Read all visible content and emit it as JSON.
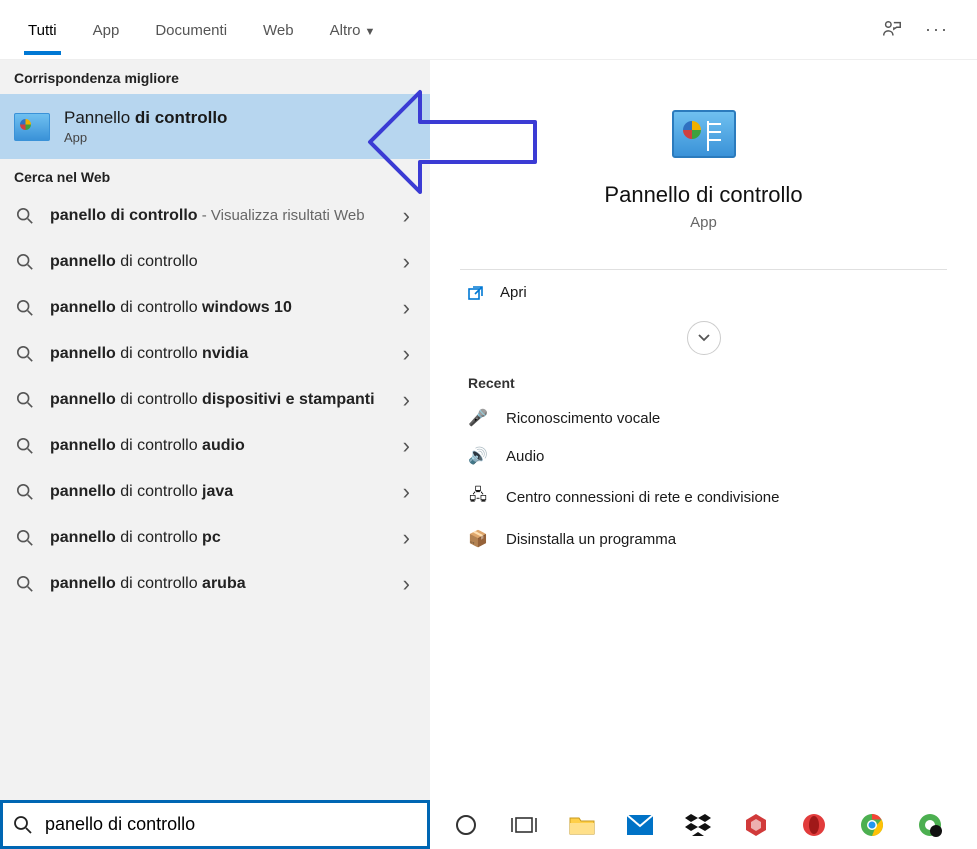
{
  "tabs": {
    "all": "Tutti",
    "apps": "App",
    "documents": "Documenti",
    "web": "Web",
    "more": "Altro"
  },
  "sections": {
    "best_match": "Corrispondenza migliore",
    "web_search": "Cerca nel Web",
    "recent": "Recent"
  },
  "best_match": {
    "title_prefix": "Pannello ",
    "title_bold": "di controllo",
    "subtitle": "App"
  },
  "web_results": [
    {
      "bold": "panello di controllo",
      "rest": "",
      "hint": " - Visualizza risultati Web"
    },
    {
      "bold": "pannello",
      "rest": " di controllo",
      "hint": ""
    },
    {
      "bold": "pannello",
      "rest": " di controllo ",
      "bold2": "windows 10"
    },
    {
      "bold": "pannello",
      "rest": " di controllo ",
      "bold2": "nvidia"
    },
    {
      "bold": "pannello",
      "rest": " di controllo ",
      "bold2": "dispositivi e stampanti"
    },
    {
      "bold": "pannello",
      "rest": " di controllo ",
      "bold2": "audio"
    },
    {
      "bold": "pannello",
      "rest": " di controllo ",
      "bold2": "java"
    },
    {
      "bold": "pannello",
      "rest": " di controllo ",
      "bold2": "pc"
    },
    {
      "bold": "pannello",
      "rest": " di controllo ",
      "bold2": "aruba"
    }
  ],
  "preview": {
    "title": "Pannello di controllo",
    "subtitle": "App",
    "open": "Apri"
  },
  "recent": [
    {
      "icon": "🎤",
      "label": "Riconoscimento vocale"
    },
    {
      "icon": "🔊",
      "label": "Audio"
    },
    {
      "icon": "🖧",
      "label": "Centro connessioni di rete e condivisione"
    },
    {
      "icon": "📦",
      "label": "Disinstalla un programma"
    }
  ],
  "search": {
    "value": "panello di controllo"
  }
}
